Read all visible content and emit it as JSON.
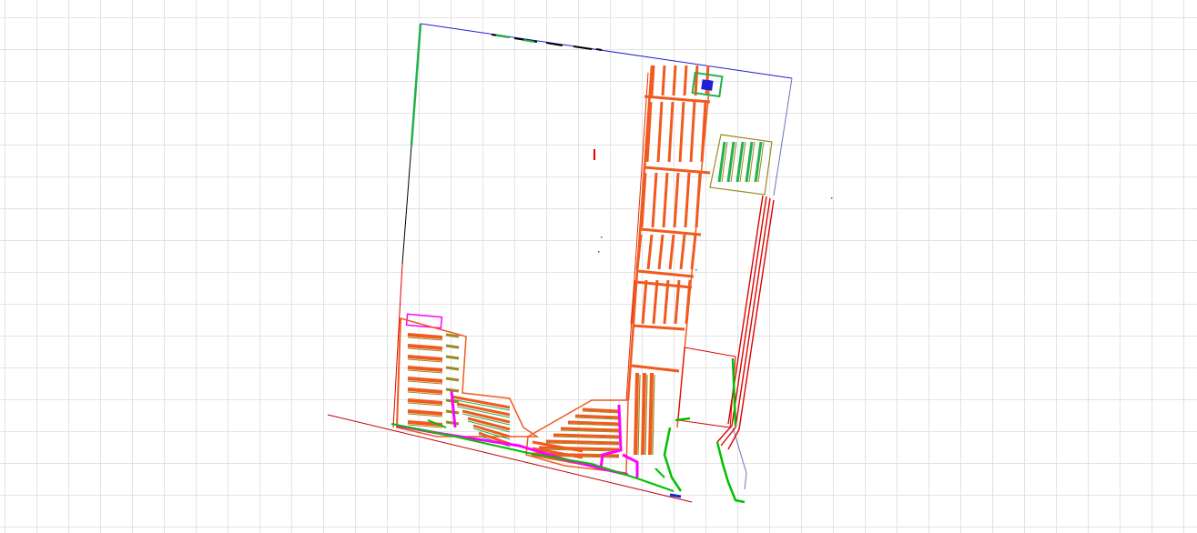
{
  "viewer": {
    "background_color": "#ffffff",
    "grid_color": "#e3e3e3",
    "grid_visible": true
  },
  "drawing": {
    "layer_colors": {
      "boundary": "#1f1fd6",
      "boundary_light": "#7070c0",
      "parking": "#f05a1e",
      "parking_dark": "#e03010",
      "stalls_green": "#22b14c",
      "stalls_olive": "#9a8a20",
      "landscape": "#00c000",
      "utility": "#ff00ff",
      "road": "#e00000",
      "edge_black": "#000000"
    },
    "icons": [
      "site-plan-drawing"
    ]
  }
}
